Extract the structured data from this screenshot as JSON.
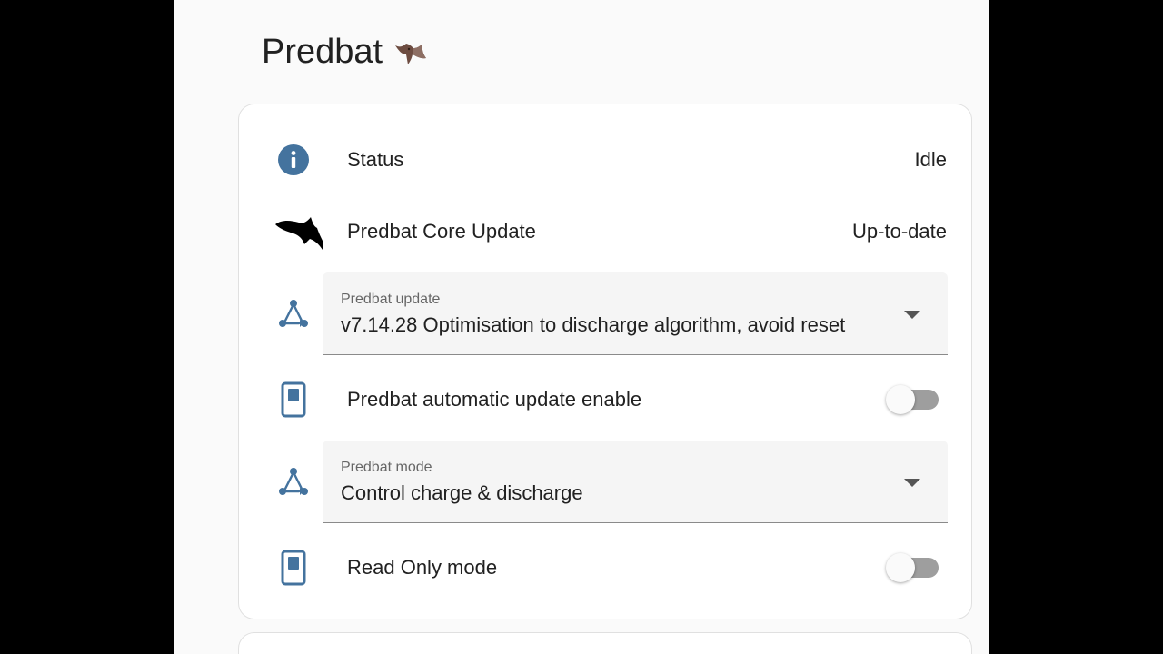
{
  "page": {
    "title": "Predbat",
    "title_emoji": "bat-emoji"
  },
  "rows": {
    "status": {
      "icon": "info-circle-icon",
      "label": "Status",
      "value": "Idle"
    },
    "core_update": {
      "icon": "bat-silhouette-icon",
      "label": "Predbat Core Update",
      "value": "Up-to-date"
    },
    "update_select": {
      "icon": "format-list-icon",
      "label": "Predbat update",
      "value": "v7.14.28 Optimisation to discharge algorithm, avoid reset"
    },
    "auto_update": {
      "icon": "switch-icon",
      "label": "Predbat automatic update enable",
      "toggle_on": false
    },
    "mode_select": {
      "icon": "format-list-icon",
      "label": "Predbat mode",
      "value": "Control charge & discharge"
    },
    "read_only": {
      "icon": "switch-icon",
      "label": "Read Only mode",
      "toggle_on": false
    }
  },
  "colors": {
    "icon_blue": "#44739e",
    "background": "#fafafa",
    "card": "#ffffff",
    "text": "#212121",
    "toggle_track_off": "#9e9e9e"
  }
}
